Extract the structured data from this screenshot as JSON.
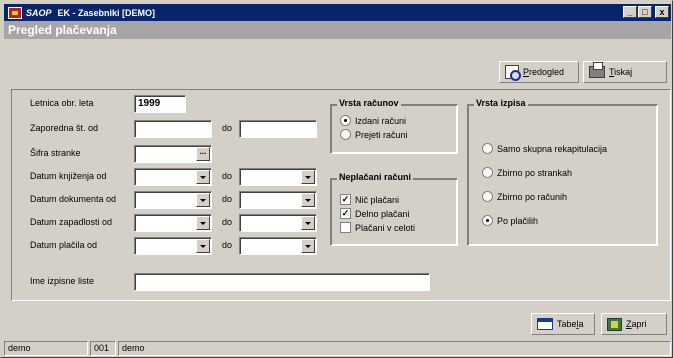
{
  "window": {
    "app_name": "SAOP",
    "title": "EK - Zasebniki [DEMO]",
    "min_label": "_",
    "max_label": "□",
    "close_label": "x"
  },
  "header": {
    "title": "Pregled plačevanja"
  },
  "toolbar": {
    "preview_first": "P",
    "preview_rest": "redogled",
    "print_first": "T",
    "print_rest": "iskaj"
  },
  "form": {
    "year_label": "Letnica obr. leta",
    "year_value": "1999",
    "seq_label": "Zaporedna št. od",
    "seq_to_label": "do",
    "code_label": "Šifra stranke",
    "ellipsis": "...",
    "booking_label": "Datum knjiženja od",
    "booking_to_label": "do",
    "doc_label": "Datum dokumenta od",
    "doc_to_label": "do",
    "due_label": "Datum zapadlosti od",
    "due_to_label": "do",
    "pay_label": "Datum plačila od",
    "pay_to_label": "do",
    "printlist_label": "Ime izpisne liste"
  },
  "invoice_type": {
    "title": "Vrsta računov",
    "options": [
      "Izdani računi",
      "Prejeti računi"
    ],
    "selected": 0
  },
  "unpaid": {
    "title": "Neplačani računi",
    "options": [
      {
        "label": "Nič plačani",
        "checked": true
      },
      {
        "label": "Delno plačani",
        "checked": true
      },
      {
        "label": "Plačani v celoti",
        "checked": false
      }
    ]
  },
  "print_type": {
    "title": "Vrsta izpisa",
    "options": [
      "Samo skupna rekapitulacija",
      "Zbirno po strankah",
      "Zbirno po računih",
      "Po plačilih"
    ],
    "selected": 3
  },
  "bottom": {
    "table_first": "Tabe",
    "table_u": "l",
    "table_rest": "a",
    "close_first": "Z",
    "close_rest": "apri"
  },
  "status": {
    "user": "demo",
    "code": "001",
    "company": "demo"
  }
}
